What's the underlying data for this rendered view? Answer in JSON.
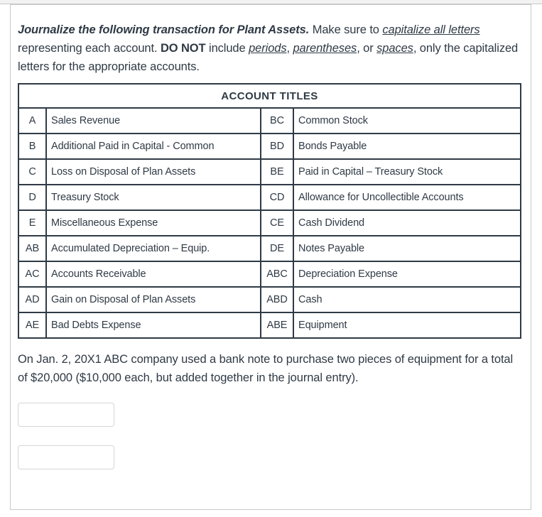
{
  "instructions": {
    "bold_italic_lead": "Journalize the following transaction for Plant Assets.",
    "seg_make_sure": " Make sure to ",
    "underline_1": "capitalize all letters",
    "seg_representing": " representing each account. ",
    "bold_donot": "DO NOT",
    "seg_include": " include ",
    "underline_2": "periods",
    "seg_comma_1": ", ",
    "underline_3": "parentheses",
    "seg_or": ", or ",
    "underline_4": "spaces",
    "seg_tail": ", only the capitalized letters for the appropriate accounts."
  },
  "table": {
    "header": "ACCOUNT TITLES",
    "rows": [
      {
        "left_code": "A",
        "left_name": "Sales Revenue",
        "right_code": "BC",
        "right_name": "Common Stock"
      },
      {
        "left_code": "B",
        "left_name": "Additional Paid in Capital - Common",
        "right_code": "BD",
        "right_name": "Bonds Payable"
      },
      {
        "left_code": "C",
        "left_name": "Loss on Disposal of Plan Assets",
        "right_code": "BE",
        "right_name": "Paid in Capital – Treasury Stock"
      },
      {
        "left_code": "D",
        "left_name": "Treasury Stock",
        "right_code": "CD",
        "right_name": "Allowance for Uncollectible Accounts"
      },
      {
        "left_code": "E",
        "left_name": "Miscellaneous Expense",
        "right_code": "CE",
        "right_name": "Cash Dividend"
      },
      {
        "left_code": "AB",
        "left_name": "Accumulated Depreciation – Equip.",
        "right_code": "DE",
        "right_name": "Notes Payable"
      },
      {
        "left_code": "AC",
        "left_name": "Accounts Receivable",
        "right_code": "ABC",
        "right_name": "Depreciation Expense"
      },
      {
        "left_code": "AD",
        "left_name": "Gain on Disposal of Plan Assets",
        "right_code": "ABD",
        "right_name": "Cash"
      },
      {
        "left_code": "AE",
        "left_name": "Bad Debts Expense",
        "right_code": "ABE",
        "right_name": "Equipment"
      }
    ]
  },
  "transaction": {
    "text": "On Jan. 2, 20X1 ABC company used a bank note to purchase two pieces of equipment for a total of $20,000 ($10,000 each, but added together in the journal entry)."
  },
  "answers": {
    "field_1_value": "",
    "field_1_placeholder": "",
    "field_2_value": "",
    "field_2_placeholder": ""
  },
  "colors": {
    "text": "#2f3a45",
    "table_border": "#2f3a45",
    "input_border": "#d6d6d6",
    "page_border": "#c9c9c9"
  }
}
